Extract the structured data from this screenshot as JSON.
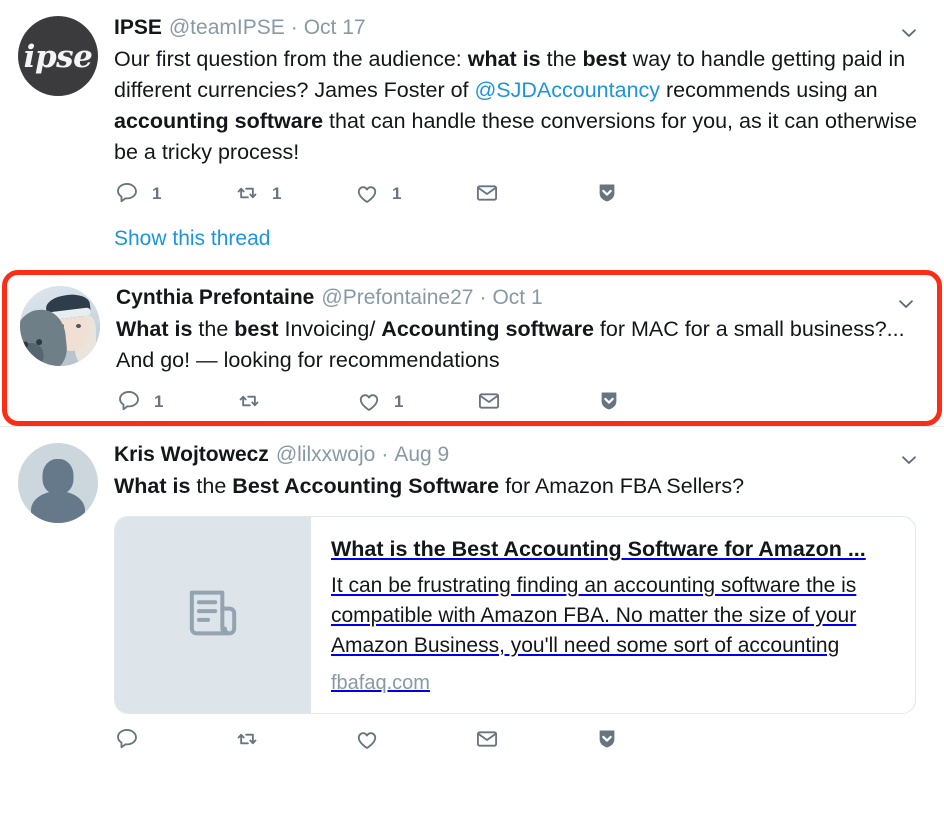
{
  "app": {
    "name": "twitter-timeline"
  },
  "colors": {
    "link": "#1b95e0",
    "muted": "#8899a6",
    "action": "#66757f",
    "highlight": "#fb2d16",
    "border": "#e6ecf0",
    "card_border": "#e1e8ed",
    "thumb_bg": "#dde4ea",
    "avatar_ipse_bg": "#3b3b3d"
  },
  "icons": {
    "reply": "reply-icon",
    "retweet": "retweet-icon",
    "like": "heart-icon",
    "dm": "envelope-icon",
    "more": "shield-chevron-down-icon",
    "caret": "chevron-down-icon",
    "article": "article-placeholder-icon",
    "person": "person-silhouette-icon"
  },
  "tweets": [
    {
      "id": "tweet-ipse",
      "highlighted": false,
      "avatar": {
        "type": "logo",
        "text": "ipse",
        "alt": "ipse-logo-avatar"
      },
      "name": "IPSE",
      "handle": "@teamIPSE",
      "separator": "·",
      "time": "Oct 17",
      "text_runs": [
        {
          "t": "Our first question from the audience: ",
          "style": "normal"
        },
        {
          "t": "what is",
          "style": "bold"
        },
        {
          "t": " the ",
          "style": "normal"
        },
        {
          "t": "best",
          "style": "bold"
        },
        {
          "t": " way to handle getting paid in different currencies? James Foster of ",
          "style": "normal"
        },
        {
          "t": "@SJDAccountancy",
          "style": "mention"
        },
        {
          "t": " recommends using an ",
          "style": "normal"
        },
        {
          "t": "accounting software",
          "style": "bold"
        },
        {
          "t": " that can handle these conversions for you, as it can otherwise be a tricky process!",
          "style": "normal"
        }
      ],
      "actions": {
        "reply": "1",
        "retweet": "1",
        "like": "1",
        "dm": "",
        "more": ""
      },
      "show_thread": "Show this thread",
      "card": null
    },
    {
      "id": "tweet-cynthia",
      "highlighted": true,
      "avatar": {
        "type": "photo",
        "alt": "woman-with-dog-avatar"
      },
      "name": "Cynthia Prefontaine",
      "handle": "@Prefontaine27",
      "separator": "·",
      "time": "Oct 1",
      "text_runs": [
        {
          "t": "What is",
          "style": "bold"
        },
        {
          "t": " the ",
          "style": "normal"
        },
        {
          "t": "best",
          "style": "bold"
        },
        {
          "t": " Invoicing/ ",
          "style": "normal"
        },
        {
          "t": "Accounting software",
          "style": "bold"
        },
        {
          "t": " for MAC for a small business?... And go! — looking for recommendations",
          "style": "normal"
        }
      ],
      "actions": {
        "reply": "1",
        "retweet": "",
        "like": "1",
        "dm": "",
        "more": ""
      },
      "show_thread": "",
      "card": null
    },
    {
      "id": "tweet-kris",
      "highlighted": false,
      "avatar": {
        "type": "default",
        "alt": "default-person-avatar"
      },
      "name": "Kris Wojtowecz",
      "handle": "@lilxxwojo",
      "separator": "·",
      "time": "Aug 9",
      "text_runs": [
        {
          "t": "What is",
          "style": "bold"
        },
        {
          "t": " the ",
          "style": "normal"
        },
        {
          "t": "Best Accounting Software",
          "style": "bold"
        },
        {
          "t": " for Amazon FBA Sellers?",
          "style": "normal"
        }
      ],
      "actions": {
        "reply": "",
        "retweet": "",
        "like": "",
        "dm": "",
        "more": ""
      },
      "show_thread": "",
      "card": {
        "title": "What is the Best Accounting Software for Amazon ...",
        "description": "It can be frustrating finding an accounting software the is compatible with Amazon FBA. No matter the size of your Amazon Business, you'll need some sort of accounting",
        "domain": "fbafaq.com"
      }
    }
  ]
}
